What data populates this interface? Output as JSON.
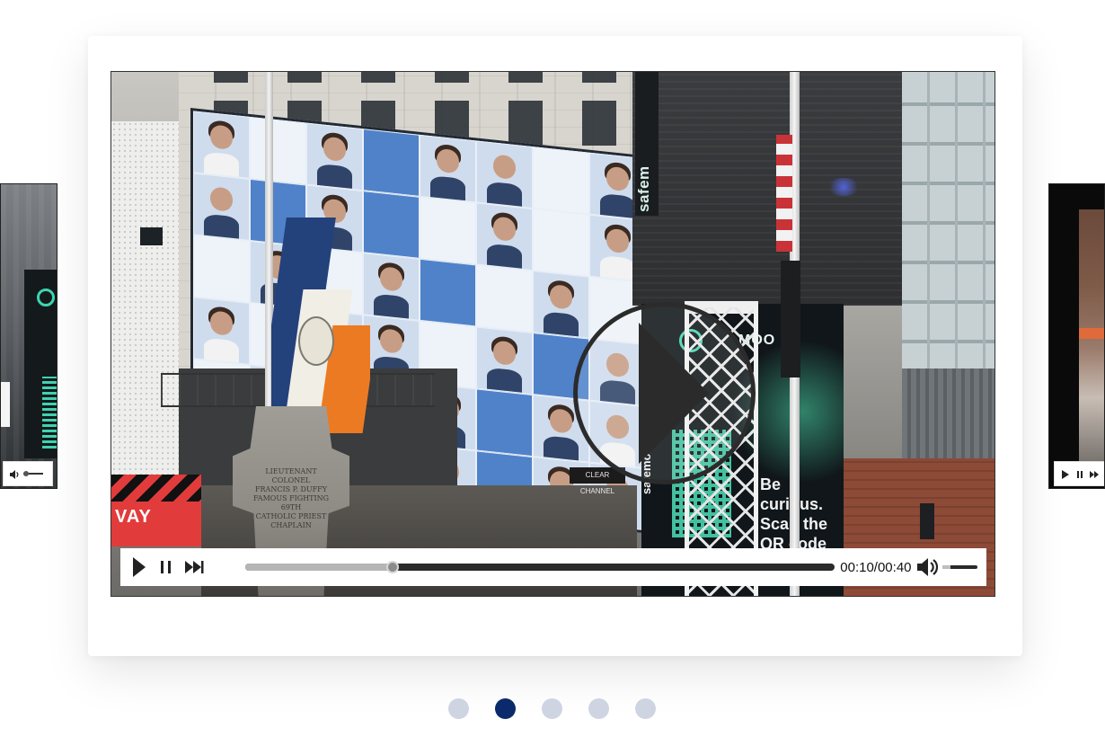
{
  "carousel": {
    "active_index": 1,
    "dot_count": 5,
    "dots": [
      {
        "label": "Slide 1",
        "active": false
      },
      {
        "label": "Slide 2",
        "active": true
      },
      {
        "label": "Slide 3",
        "active": false
      },
      {
        "label": "Slide 4",
        "active": false
      },
      {
        "label": "Slide 5",
        "active": false
      }
    ],
    "colors": {
      "dot_active": "#0b2a6b",
      "dot_inactive": "#cfd4e2"
    }
  },
  "main_video": {
    "time_display": "00:10/00:40",
    "progress_fraction": 0.25,
    "volume_fraction": 0.25,
    "icons": {
      "big_play": "play-circle-icon",
      "play": "play-icon",
      "pause": "pause-icon",
      "next": "skip-next-icon",
      "volume": "volume-icon"
    },
    "scene_text": {
      "safe_strip": "safem",
      "red_sign": "VAY",
      "monument": [
        "LIEUTENANT COLONEL",
        "FRANCIS P. DUFFY",
        "FAMOUS FIGHTING 69TH",
        "CATHOLIC PRIEST",
        "CHAPLAIN"
      ],
      "clear_channel": "CLEAR CHANNEL",
      "moo": "MOO",
      "curious": "Be curious. Scan the QR code",
      "vertical_sign": "safemoon"
    }
  },
  "side_left": {
    "icons": {
      "volume": "volume-icon"
    }
  },
  "side_right": {
    "icons": {
      "play": "play-icon",
      "pause": "pause-icon",
      "next": "skip-next-icon"
    }
  }
}
